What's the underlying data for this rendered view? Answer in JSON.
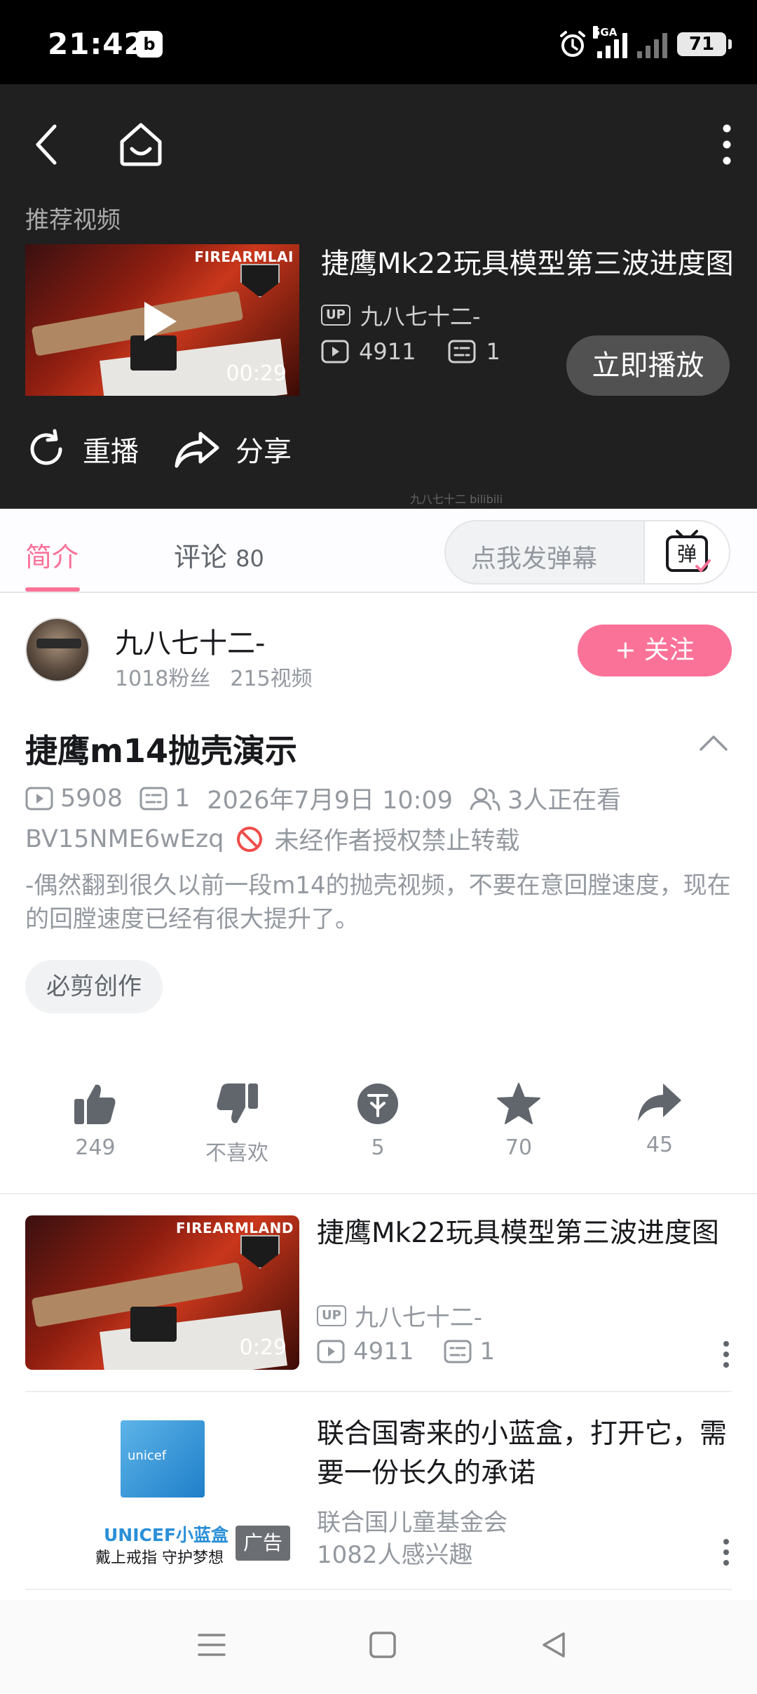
{
  "status_bar": {
    "time": "21:42",
    "app_icon": "bilibili-tv-icon",
    "network_label": "5GA",
    "battery": "71"
  },
  "player_panel": {
    "recommend_label": "推荐视频",
    "recommended": {
      "title": "捷鹰Mk22玩具模型第三波进度图",
      "uploader": "九八七十二-",
      "views": "4911",
      "danmaku": "1",
      "duration": "00:29",
      "thumb_brand": "FIREARMLAI"
    },
    "play_now_label": "立即播放",
    "replay_label": "重播",
    "share_label": "分享",
    "watermark": "九八七十二 bilibili"
  },
  "tabs": {
    "intro_label": "简介",
    "comments_label": "评论",
    "comments_count": "80",
    "danmaku_placeholder": "点我发弹幕",
    "danmaku_button": "弹"
  },
  "uploader": {
    "name": "九八七十二-",
    "fans": "1018粉丝",
    "videos": "215视频",
    "follow_label": "+ 关注"
  },
  "video": {
    "title": "捷鹰m14抛壳演示",
    "views": "5908",
    "danmaku": "1",
    "date": "2026年7月9日 10:09",
    "watching": "3人正在看",
    "bvid": "BV15NME6wEzq",
    "no_repost": "未经作者授权禁止转载",
    "description": "-偶然翻到很久以前一段m14的抛壳视频，不要在意回膛速度，现在的回膛速度已经有很大提升了。",
    "tag": "必剪创作"
  },
  "actions": {
    "like": "249",
    "dislike": "不喜欢",
    "coin": "5",
    "favorite": "70",
    "share": "45"
  },
  "related": [
    {
      "title": "捷鹰Mk22玩具模型第三波进度图",
      "uploader": "九八七十二-",
      "views": "4911",
      "danmaku": "1",
      "duration": "0:29",
      "thumb_brand": "FIREARMLAND"
    }
  ],
  "ad": {
    "title": "联合国寄来的小蓝盒，打开它，需要一份长久的承诺",
    "source": "联合国儿童基金会",
    "interest": "1082人感兴趣",
    "badge": "广告",
    "image_line1": "UNICEF小蓝盒",
    "image_line2": "戴上戒指 守护梦想",
    "box_text": "unicef"
  },
  "colors": {
    "accent": "#fb7299",
    "panel_bg": "#1f201f",
    "muted_text": "#9499a0"
  }
}
